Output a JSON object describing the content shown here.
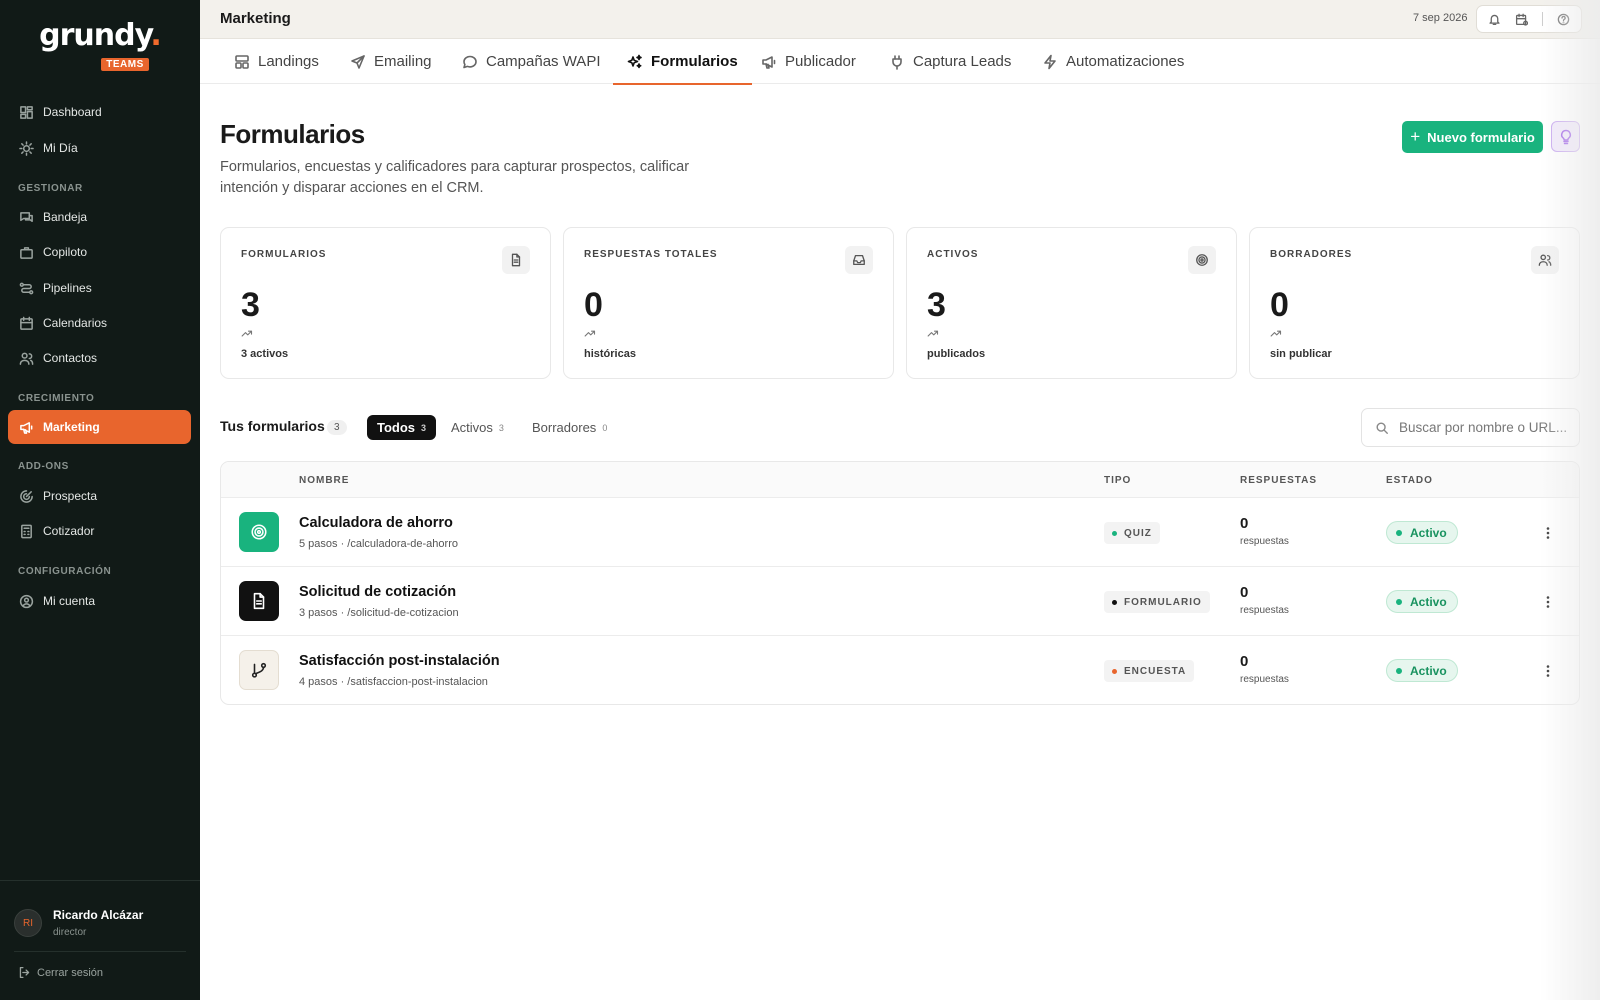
{
  "brand": {
    "name": "grundy",
    "dot": ".",
    "badge": "TEAMS"
  },
  "sidebar": {
    "items": [
      {
        "label": "Dashboard",
        "icon": "dashboard-icon"
      },
      {
        "label": "Mi Día",
        "icon": "sun-icon"
      }
    ],
    "sections": [
      {
        "title": "GESTIONAR",
        "items": [
          {
            "label": "Bandeja",
            "icon": "inbox-chat-icon"
          },
          {
            "label": "Copiloto",
            "icon": "briefcase-icon"
          },
          {
            "label": "Pipelines",
            "icon": "pipeline-icon"
          },
          {
            "label": "Calendarios",
            "icon": "calendar-icon"
          },
          {
            "label": "Contactos",
            "icon": "contacts-icon"
          }
        ]
      },
      {
        "title": "CRECIMIENTO",
        "items": [
          {
            "label": "Marketing",
            "icon": "megaphone-icon",
            "active": true
          }
        ]
      },
      {
        "title": "ADD-ONS",
        "items": [
          {
            "label": "Prospecta",
            "icon": "radar-icon"
          },
          {
            "label": "Cotizador",
            "icon": "calculator-icon"
          }
        ]
      },
      {
        "title": "CONFIGURACIÓN",
        "items": [
          {
            "label": "Mi cuenta",
            "icon": "account-icon"
          }
        ]
      }
    ],
    "user": {
      "initials": "RI",
      "name": "Ricardo Alcázar",
      "role": "director"
    },
    "logout": "Cerrar sesión"
  },
  "topbar": {
    "title": "Marketing",
    "date": "7 sep 2026"
  },
  "tabs": [
    {
      "label": "Landings",
      "icon": "layout-icon"
    },
    {
      "label": "Emailing",
      "icon": "send-icon"
    },
    {
      "label": "Campañas WAPI",
      "icon": "chat-bubble-icon"
    },
    {
      "label": "Formularios",
      "icon": "sparkles-icon",
      "active": true
    },
    {
      "label": "Publicador",
      "icon": "megaphone-icon"
    },
    {
      "label": "Captura Leads",
      "icon": "plug-icon"
    },
    {
      "label": "Automatizaciones",
      "icon": "bolt-icon"
    }
  ],
  "page": {
    "title": "Formularios",
    "subtitle": "Formularios, encuestas y calificadores para capturar prospectos, calificar intención y disparar acciones en el CRM.",
    "new_button": "Nuevo formulario"
  },
  "stats": [
    {
      "label": "FORMULARIOS",
      "value": "3",
      "caption": "3 activos",
      "icon": "document-icon"
    },
    {
      "label": "RESPUESTAS TOTALES",
      "value": "0",
      "caption": "históricas",
      "icon": "inbox-icon"
    },
    {
      "label": "ACTIVOS",
      "value": "3",
      "caption": "publicados",
      "icon": "target-icon"
    },
    {
      "label": "BORRADORES",
      "value": "0",
      "caption": "sin publicar",
      "icon": "users-icon"
    }
  ],
  "list": {
    "title": "Tus formularios",
    "count": "3",
    "filters": [
      {
        "label": "Todos",
        "count": "3",
        "active": true
      },
      {
        "label": "Activos",
        "count": "3"
      },
      {
        "label": "Borradores",
        "count": "0"
      }
    ],
    "search_placeholder": "Buscar por nombre o URL..."
  },
  "table": {
    "headers": {
      "name": "NOMBRE",
      "type": "TIPO",
      "responses": "RESPUESTAS",
      "status": "ESTADO"
    },
    "rows": [
      {
        "name": "Calculadora de ahorro",
        "meta": "5 pasos · /calculadora-de-ahorro",
        "type": "QUIZ",
        "type_color": "#19b37e",
        "responses": "0",
        "responses_label": "respuestas",
        "status": "Activo",
        "icon": "target-icon",
        "icon_bg": "#19b37e"
      },
      {
        "name": "Solicitud de cotización",
        "meta": "3 pasos · /solicitud-de-cotizacion",
        "type": "FORMULARIO",
        "type_color": "#111111",
        "responses": "0",
        "responses_label": "respuestas",
        "status": "Activo",
        "icon": "document-icon",
        "icon_bg": "#111111"
      },
      {
        "name": "Satisfacción post-instalación",
        "meta": "4 pasos · /satisfaccion-post-instalacion",
        "type": "ENCUESTA",
        "type_color": "#e8652d",
        "responses": "0",
        "responses_label": "respuestas",
        "status": "Activo",
        "icon": "branch-icon",
        "icon_bg": "#f5f1ea"
      }
    ]
  },
  "colors": {
    "accent": "#e8652d",
    "success": "#19b37e",
    "sidebar_bg": "#111a17"
  }
}
